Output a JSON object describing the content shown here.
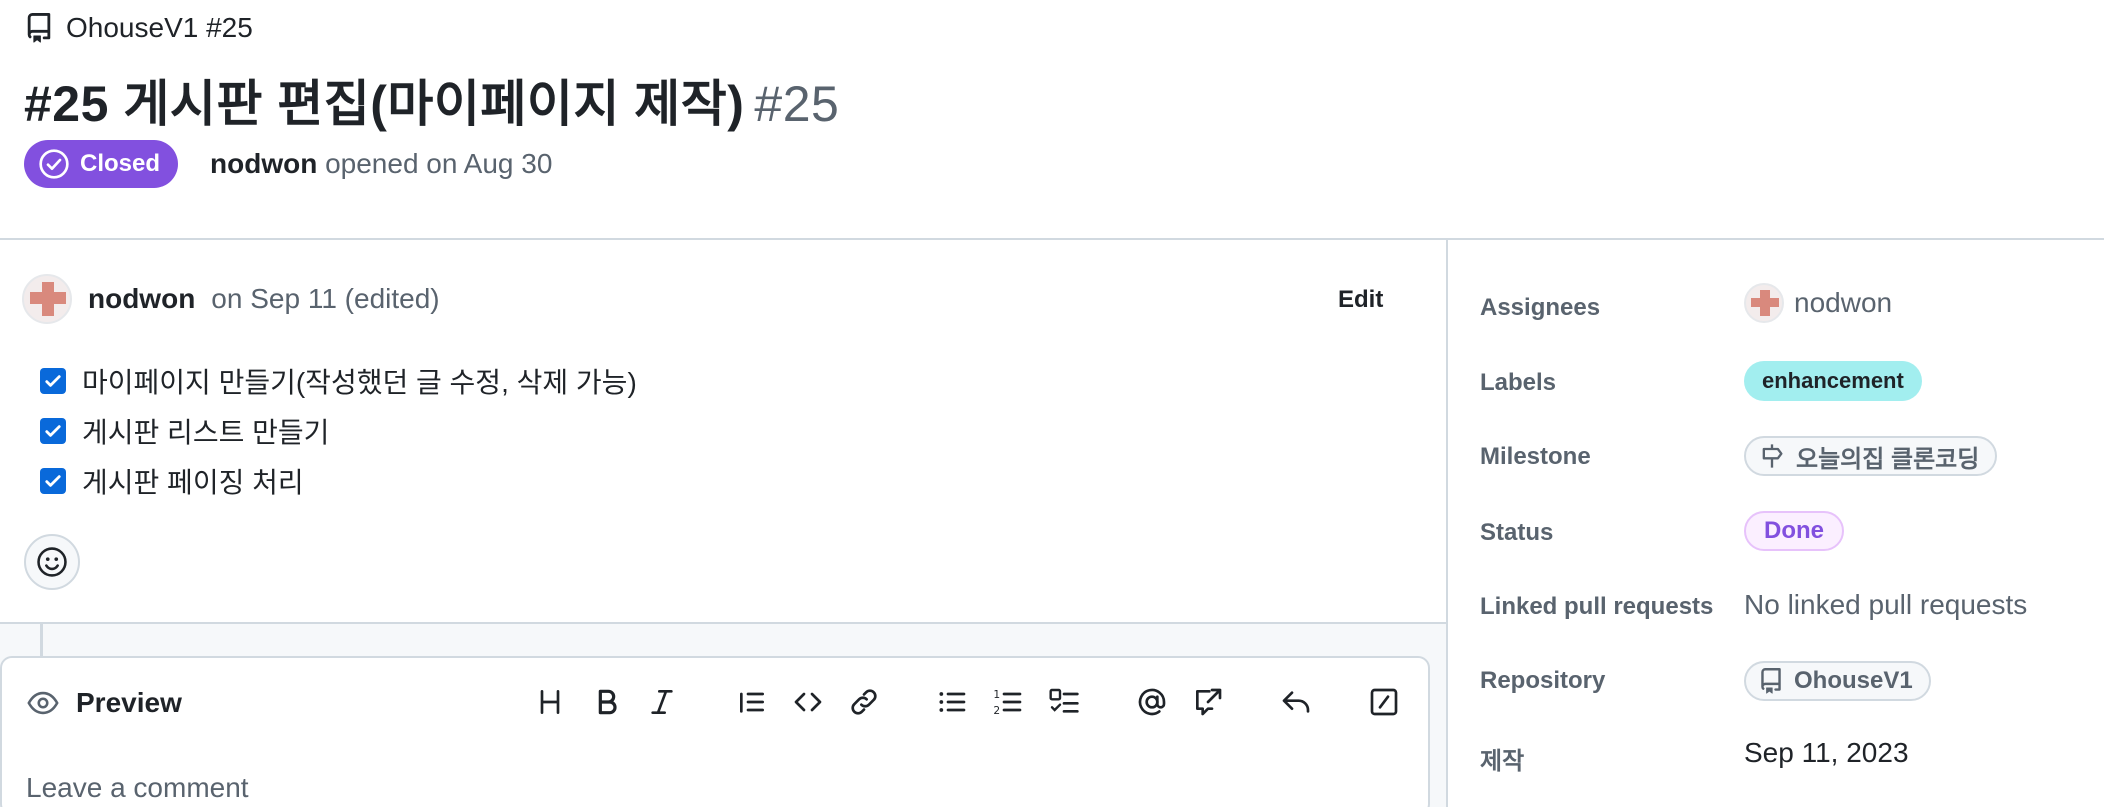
{
  "header": {
    "repo_name": "OhouseV1 #25",
    "title": "#25 게시판 편집(마이페이지 제작)",
    "title_number": "#25",
    "state": "Closed",
    "author": "nodwon",
    "opened_text": "opened on Aug 30"
  },
  "comment": {
    "author": "nodwon",
    "timestamp": "on Sep 11 (edited)",
    "edit_label": "Edit",
    "tasks": [
      {
        "label": "마이페이지 만들기(작성했던 글 수정, 삭제 가능)",
        "checked": true
      },
      {
        "label": "게시판 리스트 만들기",
        "checked": true
      },
      {
        "label": "게시판 페이징 처리",
        "checked": true
      }
    ],
    "reaction_icon": "smiley-icon"
  },
  "editor": {
    "preview_label": "Preview",
    "placeholder": "Leave a comment",
    "toolbar": [
      "heading-icon",
      "bold-icon",
      "italic-icon",
      "quote-icon",
      "code-icon",
      "link-icon",
      "unordered-list-icon",
      "ordered-list-icon",
      "task-list-icon",
      "mention-icon",
      "cross-reference-icon",
      "saved-reply-icon",
      "slash-commands-icon"
    ]
  },
  "sidebar": {
    "assignees_label": "Assignees",
    "assignee": "nodwon",
    "labels_label": "Labels",
    "label": "enhancement",
    "label_color": "#a2eeef",
    "milestone_label": "Milestone",
    "milestone": "오늘의집 클론코딩",
    "status_label": "Status",
    "status": "Done",
    "linked_label": "Linked pull requests",
    "linked_value": "No linked pull requests",
    "repository_label": "Repository",
    "repository": "OhouseV1",
    "custom_field_label": "제작",
    "custom_field_value": "Sep 11, 2023"
  },
  "colors": {
    "closed_badge": "#8250df",
    "checkbox": "#0969da",
    "muted_text": "#59636e",
    "border": "#d1d9e0"
  }
}
